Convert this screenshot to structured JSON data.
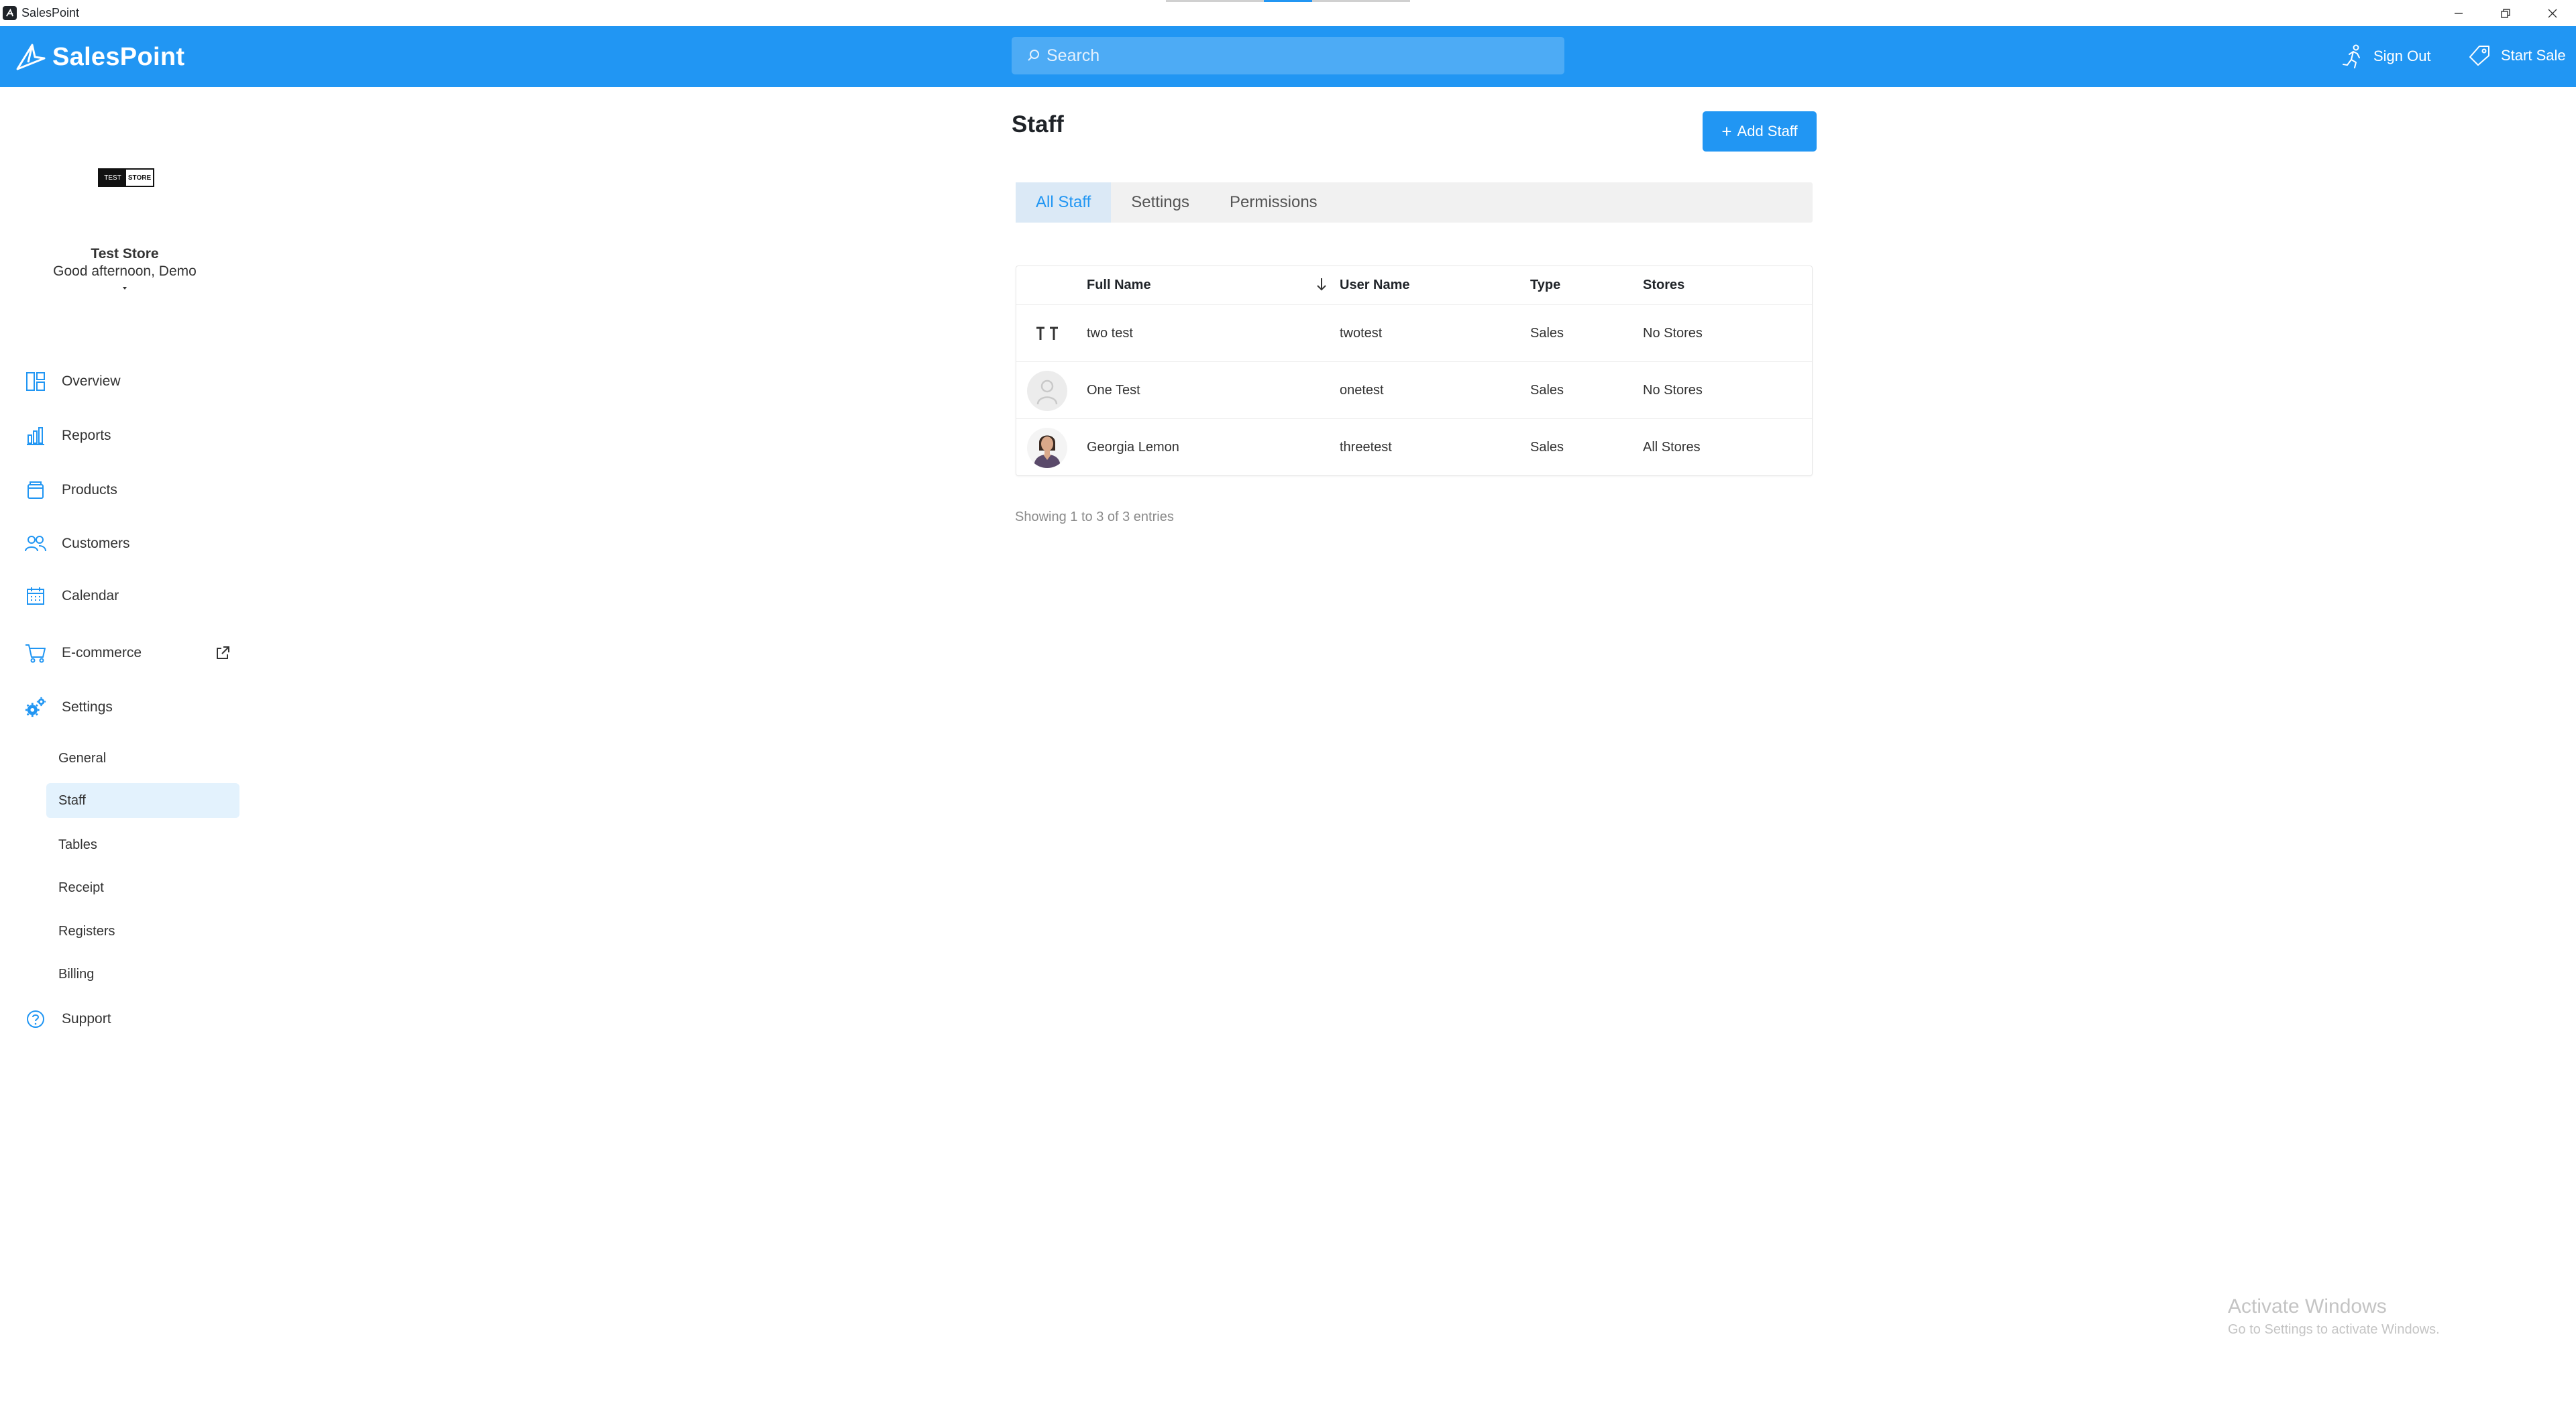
{
  "window": {
    "title": "SalesPoint",
    "controls": [
      "minimize",
      "restore",
      "close"
    ]
  },
  "header": {
    "brand": "SalesPoint",
    "search_placeholder": "Search",
    "sign_out_label": "Sign Out",
    "start_sale_label": "Start Sale"
  },
  "sidebar": {
    "store_logo": {
      "left": "TEST",
      "right": "STORE"
    },
    "store_name": "Test Store",
    "greeting": "Good afternoon, Demo",
    "nav": [
      {
        "label": "Overview",
        "icon": "overview-icon"
      },
      {
        "label": "Reports",
        "icon": "reports-icon"
      },
      {
        "label": "Products",
        "icon": "products-icon"
      },
      {
        "label": "Customers",
        "icon": "customers-icon"
      },
      {
        "label": "Calendar",
        "icon": "calendar-icon"
      },
      {
        "label": "E-commerce",
        "icon": "cart-icon",
        "external": true
      },
      {
        "label": "Settings",
        "icon": "gear-icon",
        "expanded": true
      }
    ],
    "settings_sub": [
      {
        "label": "General"
      },
      {
        "label": "Staff",
        "active": true
      },
      {
        "label": "Tables"
      },
      {
        "label": "Receipt"
      },
      {
        "label": "Registers"
      },
      {
        "label": "Billing"
      }
    ],
    "support_label": "Support"
  },
  "main": {
    "title": "Staff",
    "add_button_label": "Add Staff",
    "tabs": [
      {
        "label": "All Staff",
        "active": true
      },
      {
        "label": "Settings"
      },
      {
        "label": "Permissions"
      }
    ],
    "table": {
      "columns": [
        "Full Name",
        "User Name",
        "Type",
        "Stores"
      ],
      "sorted_column": "Full Name",
      "sort_direction": "descending",
      "rows": [
        {
          "full_name": "two test",
          "user_name": "twotest",
          "type": "Sales",
          "stores": "No Stores",
          "avatar": "initials-avatar"
        },
        {
          "full_name": "One Test",
          "user_name": "onetest",
          "type": "Sales",
          "stores": "No Stores",
          "avatar": "placeholder-avatar"
        },
        {
          "full_name": "Georgia Lemon",
          "user_name": "threetest",
          "type": "Sales",
          "stores": "All Stores",
          "avatar": "photo-avatar"
        }
      ]
    },
    "entries_text": "Showing 1 to 3 of 3 entries"
  },
  "watermark": {
    "title": "Activate Windows",
    "subtitle": "Go to Settings to activate Windows."
  },
  "colors": {
    "accent": "#2196f3",
    "header_bg": "#2196f3",
    "active_nav_bg": "#e3f2fd",
    "active_tab_bg": "#dbe9f6"
  }
}
